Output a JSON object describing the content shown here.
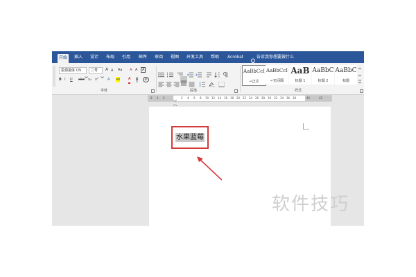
{
  "tabs": [
    {
      "label": "开始",
      "active": true
    },
    {
      "label": "插入"
    },
    {
      "label": "设计"
    },
    {
      "label": "布局"
    },
    {
      "label": "引用"
    },
    {
      "label": "邮件"
    },
    {
      "label": "审阅"
    },
    {
      "label": "视图"
    },
    {
      "label": "开发工具"
    },
    {
      "label": "帮助"
    },
    {
      "label": "Acrobat"
    }
  ],
  "tell_me": "告诉我你想要做什么",
  "font": {
    "name": "思源黑体 CN",
    "size": "二号",
    "grow": "A",
    "shrink": "A",
    "case": "Aa",
    "clear": "A",
    "phonetic": "A",
    "border_char": "A",
    "bold": "B",
    "italic": "I",
    "underline": "U",
    "strike": "abc",
    "subscript": "x₂",
    "superscript": "x²",
    "effects": "A",
    "highlight": "ab",
    "color": "A",
    "shade": "A",
    "enclose": "字",
    "group_label": "字体"
  },
  "paragraph": {
    "group_label": "段落"
  },
  "styles": {
    "items": [
      {
        "sample": "AaBbCcI",
        "name": "↵正文",
        "selected": true
      },
      {
        "sample": "AaBbCcI",
        "name": "↵无间隔"
      },
      {
        "sample": "AaB",
        "name": "标题 1"
      },
      {
        "sample": "AaBbC",
        "name": "标题 2"
      },
      {
        "sample": "AaBbC",
        "name": "标题"
      }
    ],
    "group_label": "样式"
  },
  "ruler": {
    "ticks": [
      "8",
      "4",
      "2",
      "",
      "2",
      "4",
      "6",
      "8",
      "10",
      "12",
      "14",
      "16",
      "18",
      "20",
      "22",
      "24",
      "26",
      "28",
      "30",
      "32",
      "34",
      "36",
      "38",
      "40",
      "42"
    ]
  },
  "document": {
    "text": "水果蓝莓"
  },
  "watermark": "软件技巧",
  "colors": {
    "tab_bar": "#2b579a",
    "annotation": "#d33a3a"
  }
}
